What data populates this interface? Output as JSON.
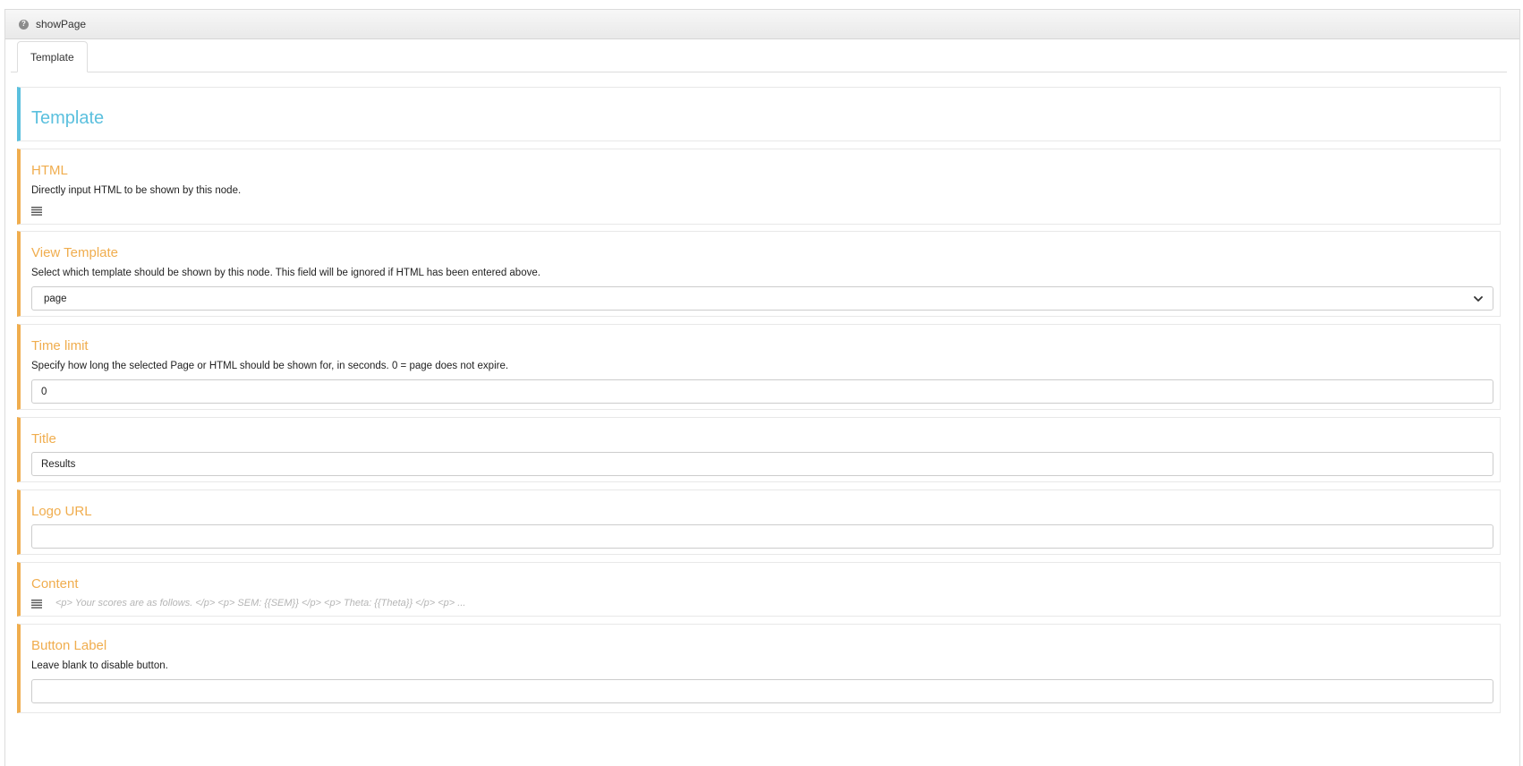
{
  "panel": {
    "title": "showPage",
    "help_icon": "question-circle-icon"
  },
  "tabs": [
    {
      "label": "Template",
      "active": true
    }
  ],
  "section_header": {
    "title": "Template"
  },
  "fields": {
    "html": {
      "label": "HTML",
      "description": "Directly input HTML to be shown by this node.",
      "icon": "lines-icon"
    },
    "view_template": {
      "label": "View Template",
      "description": "Select which template should be shown by this node. This field will be ignored if HTML has been entered above.",
      "value": "page",
      "icon": "chevron-down-icon"
    },
    "time_limit": {
      "label": "Time limit",
      "description": "Specify how long the selected Page or HTML should be shown for, in seconds. 0 = page does not expire.",
      "value": "0"
    },
    "title": {
      "label": "Title",
      "value": "Results"
    },
    "logo_url": {
      "label": "Logo URL",
      "value": ""
    },
    "content": {
      "label": "Content",
      "preview": "<p> Your scores are as follows.  </p> <p> SEM: {{SEM}} </p> <p> Theta: {{Theta}} </p> <p> ...",
      "icon": "lines-icon"
    },
    "button_label": {
      "label": "Button Label",
      "description": "Leave blank to disable button.",
      "value": ""
    }
  },
  "colors": {
    "accent_info": "#5bc0de",
    "accent_warning": "#f0ad4e",
    "header_bg": "#ececec"
  }
}
